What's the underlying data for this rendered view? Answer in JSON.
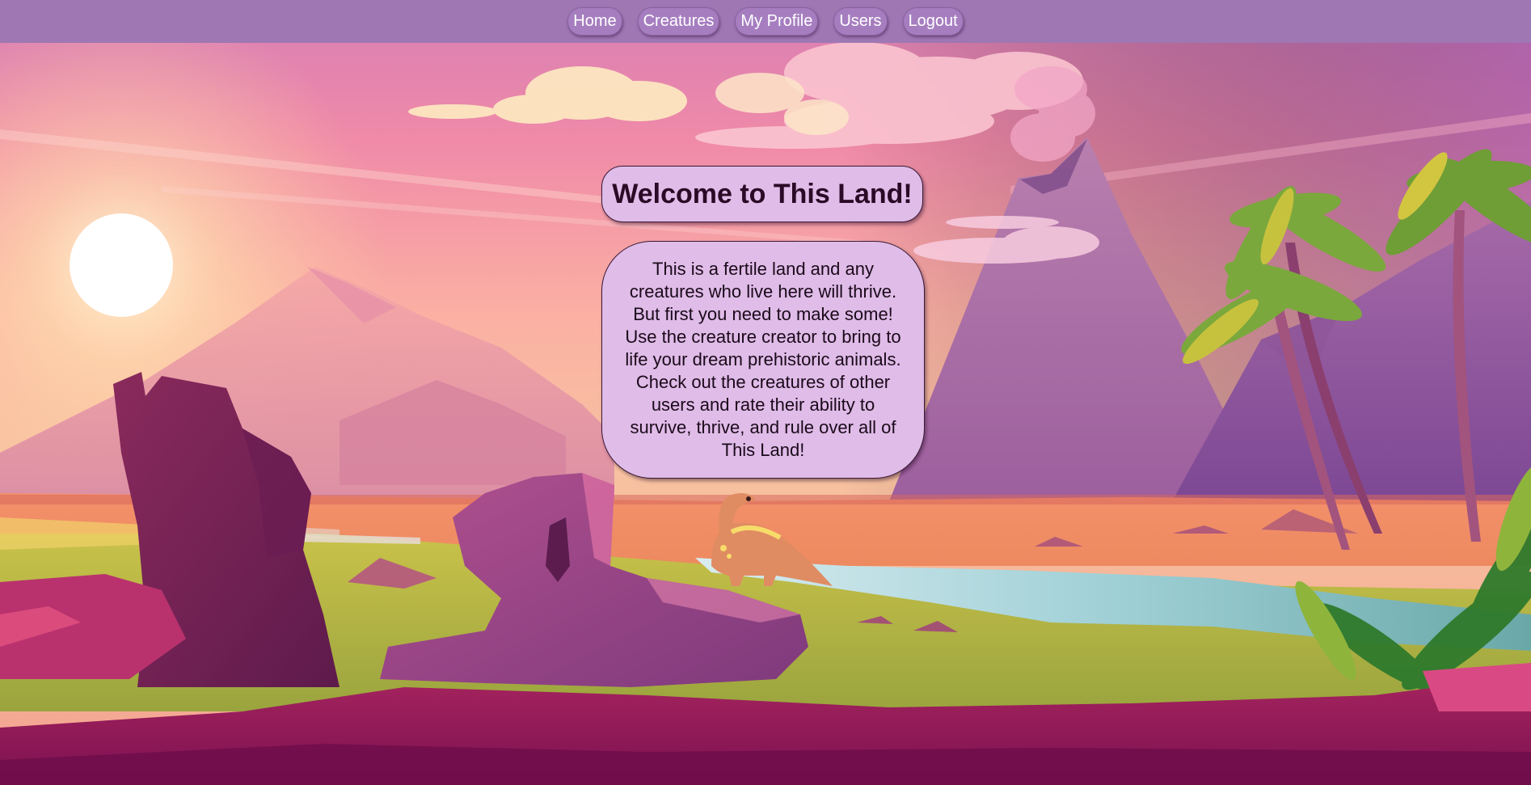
{
  "nav": {
    "items": [
      {
        "label": "Home"
      },
      {
        "label": "Creatures"
      },
      {
        "label": "My Profile"
      },
      {
        "label": "Users"
      },
      {
        "label": "Logout"
      }
    ]
  },
  "hero": {
    "title": "Welcome to This Land!",
    "description": "This is a fertile land and any creatures who live here will thrive. But first you need to make some! Use the creature creator to bring to life your dream prehistoric animals. Check out the creatures of other users and rate their ability to survive, thrive, and rule over all of This Land!"
  },
  "colors": {
    "navbar": "#9e77b3",
    "panel": "#e0bce8",
    "panel_border": "#3a1a36",
    "title_text": "#2a0a26"
  }
}
